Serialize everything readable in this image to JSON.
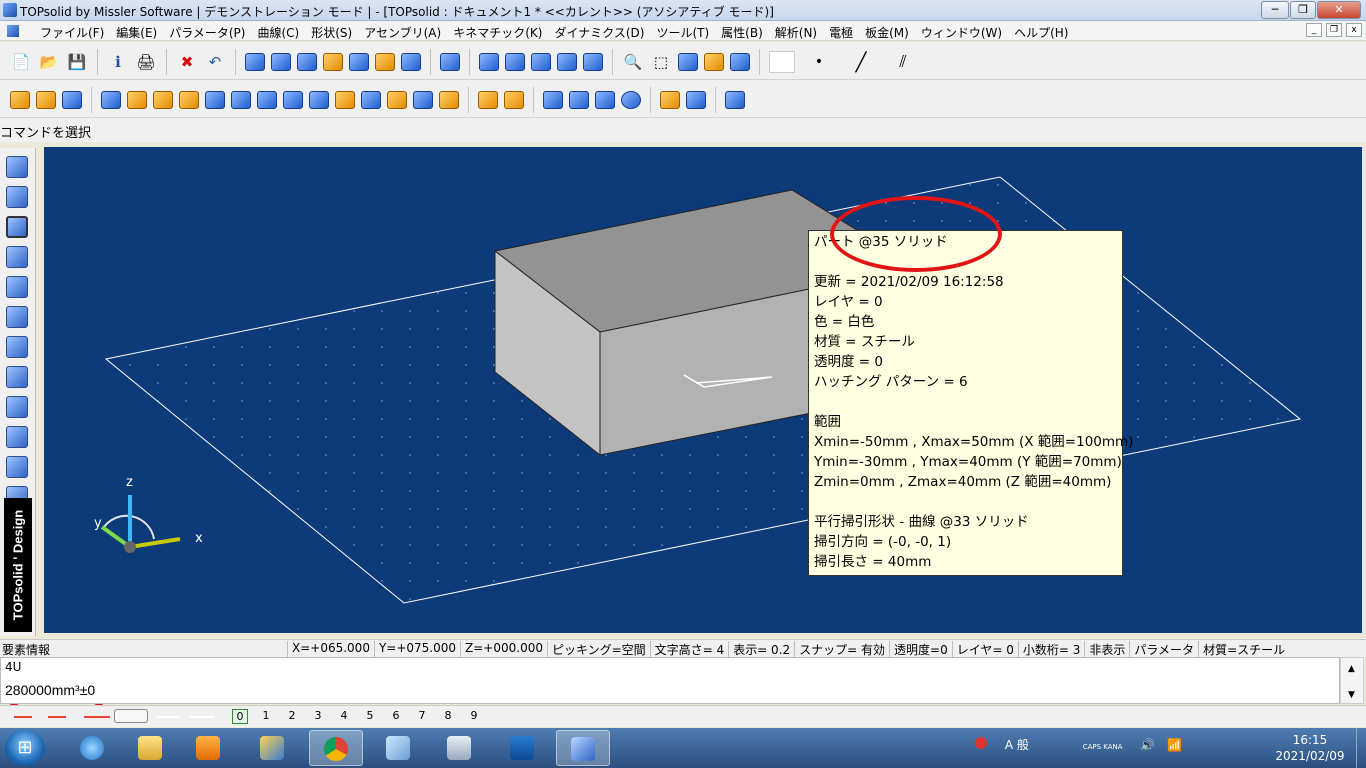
{
  "window": {
    "title": "TOPsolid by Missler Software | デモンストレーション モード | - [TOPsolid : ドキュメント1 *  <<カレント>> (アソシアティブ モード)]",
    "minimize_glyph": "─",
    "restore_glyph": "❐",
    "close_glyph": "✕"
  },
  "mdi": {
    "minimize_glyph": "_",
    "restore_glyph": "❐",
    "close_glyph": "x"
  },
  "menu": [
    "ファイル(F)",
    "編集(E)",
    "パラメータ(P)",
    "曲線(C)",
    "形状(S)",
    "アセンブリ(A)",
    "キネマチック(K)",
    "ダイナミクス(D)",
    "ツール(T)",
    "属性(B)",
    "解析(N)",
    "電極",
    "板金(M)",
    "ウィンドウ(W)",
    "ヘルプ(H)"
  ],
  "toolbar1_glyphs": [
    "📄",
    "📂",
    "💾",
    "ℹ",
    "🖨",
    "✖",
    "↶",
    "🔍",
    "⬚"
  ],
  "command_prompt": "コマンドを選択",
  "brand": "TOPsolid ' Design",
  "axes": {
    "z": "z",
    "y": "y",
    "x": "x"
  },
  "tooltip_lines": [
    "パート @35 ソリッド",
    "",
    "更新 = 2021/02/09 16:12:58",
    "レイヤ = 0",
    "色 = 白色",
    "材質 = スチール",
    "透明度 = 0",
    "ハッチング パターン = 6",
    "",
    "範囲",
    "Xmin=-50mm , Xmax=50mm (X 範囲=100mm)",
    "Ymin=-30mm , Ymax=40mm (Y 範囲=70mm)",
    "Zmin=0mm , Zmax=40mm (Z 範囲=40mm)",
    "",
    "平行掃引形状 - 曲線 @33 ソリッド",
    "掃引方向 = (-0, -0, 1)",
    "掃引長さ = 40mm"
  ],
  "status": {
    "label": "要素情報",
    "fields": [
      "X=+065.000",
      "Y=+075.000",
      "Z=+000.000",
      "ピッキング=空間",
      "文字高さ=  4",
      "表示=   0.2",
      "スナップ= 有効",
      "透明度=0",
      "レイヤ=  0",
      "小数桁= 3",
      "非表示",
      "パラメータ",
      "材質=スチール"
    ]
  },
  "info": {
    "line1": "4U",
    "line2": "280000mm³±0",
    "scroll_up": "▲",
    "scroll_down": "▼"
  },
  "layers": {
    "current": "0",
    "numbers": [
      "0",
      "1",
      "2",
      "3",
      "4",
      "5",
      "6",
      "7",
      "8",
      "9"
    ]
  },
  "taskbar": {
    "start_glyph": "⊞",
    "tray_text": "A 般",
    "caps_kana": "CAPS KANA",
    "time": "16:15",
    "date": "2021/02/09"
  }
}
